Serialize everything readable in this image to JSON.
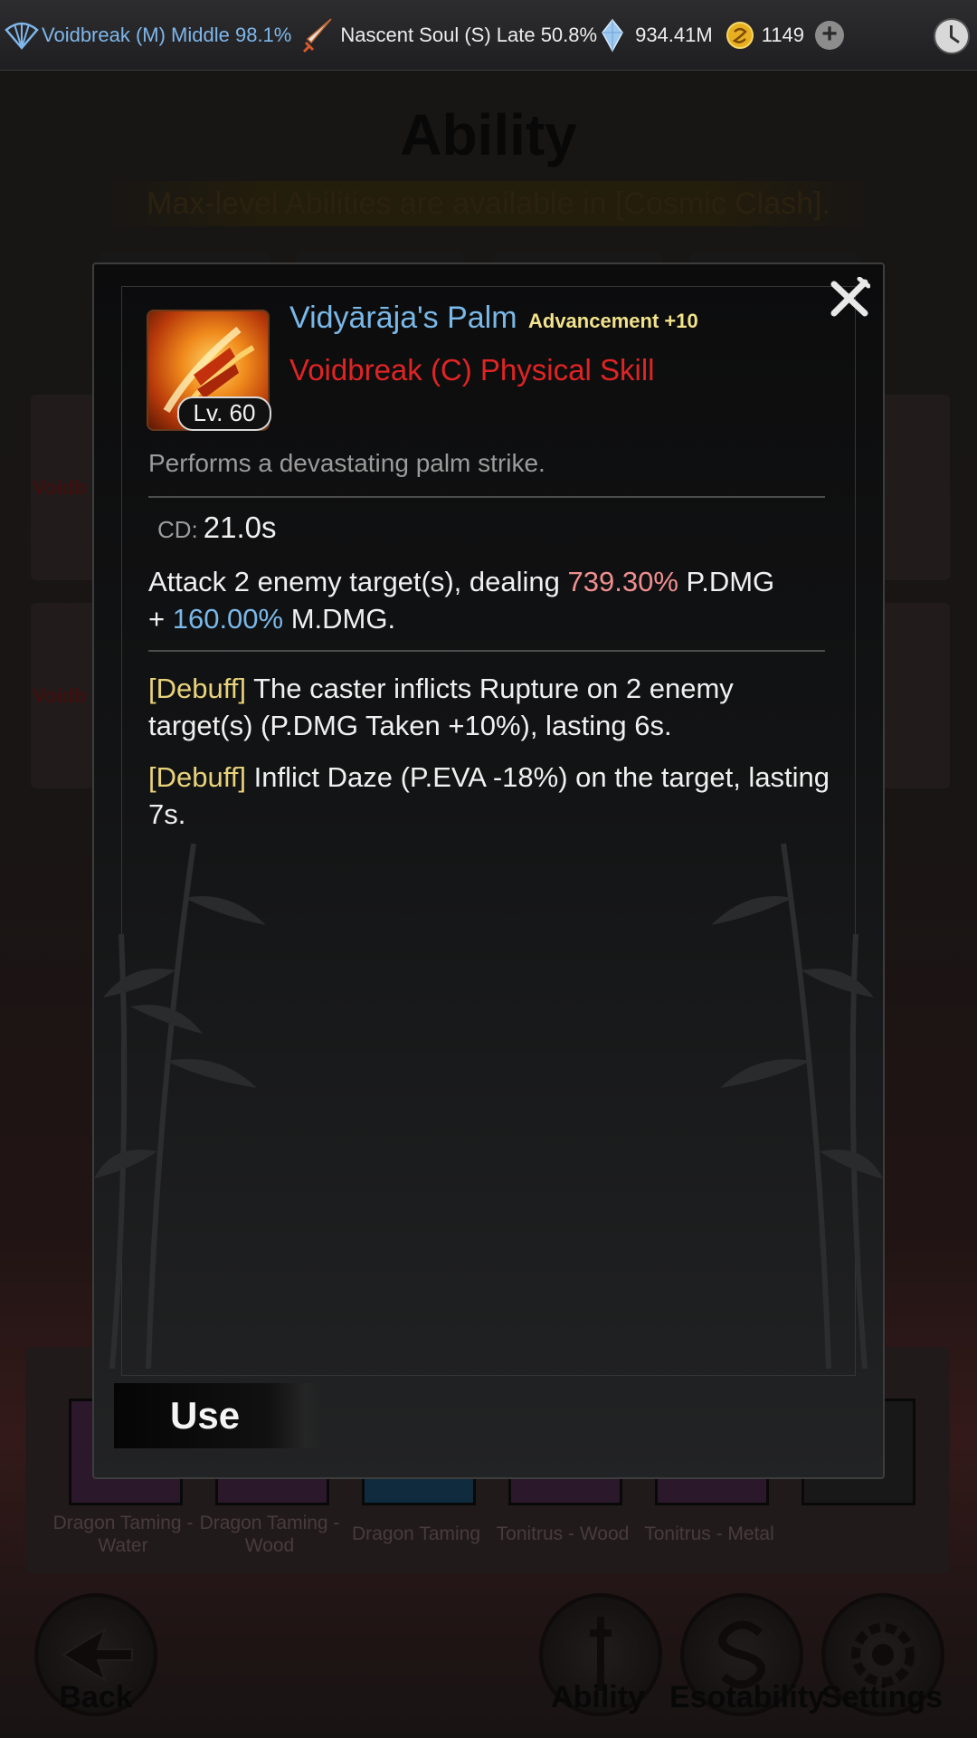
{
  "status_bar": {
    "cultivation_realm": "Voidbreak (M) Middle 98.1%",
    "soul_realm": "Nascent Soul (S) Late 50.8%",
    "spirit_stones": "934.41M",
    "gold": "1149"
  },
  "page": {
    "title": "Ability",
    "notice": "Max-level Abilities are available in [Cosmic Clash].",
    "card_labels": [
      "Voidb",
      "Voidb"
    ],
    "skill_tiles": [
      {
        "label": "Dragon Taming - Water",
        "color": "#5a2a6a"
      },
      {
        "label": "Dragon Taming - Wood",
        "color": "#6a2a6a"
      },
      {
        "label": "Dragon Taming",
        "color": "#1a4a6a"
      },
      {
        "label": "Tonitrus - Wood",
        "color": "#5a2a5a"
      },
      {
        "label": "Tonitrus - Metal",
        "color": "#5a2a6a"
      },
      {
        "label": "",
        "color": "#2a2a2a"
      }
    ],
    "nav": {
      "back": "Back",
      "ability": "Ability",
      "esotability": "Esotability",
      "settings": "Settings"
    }
  },
  "modal": {
    "skill_name": "Vidyārāja's Palm",
    "advancement": "Advancement +10",
    "skill_type": "Voidbreak (C) Physical Skill",
    "level": "Lv. 60",
    "description": "Performs a devastating palm strike.",
    "cd_label": "CD:",
    "cd_value": "21.0s",
    "attack": {
      "prefix": "Attack 2 enemy target(s), dealing ",
      "pdmg_value": "739.30%",
      "pdmg_suffix": " P.DMG",
      "plus": "+ ",
      "mdmg_value": "160.00%",
      "mdmg_suffix": " M.DMG."
    },
    "debuffs": [
      {
        "tag": "[Debuff]",
        "text": " The caster inflicts Rupture on 2 enemy target(s) (P.DMG Taken +10%), lasting 6s."
      },
      {
        "tag": "[Debuff]",
        "text": " Inflict Daze (P.EVA -18%) on the target, lasting 7s."
      }
    ],
    "use_label": "Use"
  },
  "colors": {
    "skill_name": "#7ab8e8",
    "skill_type": "#e02424",
    "advancement": "#f2e38c",
    "pdmg": "#f08f8f",
    "mdmg": "#7ab8e8",
    "debuff_tag": "#e8d27a"
  },
  "icons": [
    "fan-icon",
    "sword-icon",
    "crystal-icon",
    "coin-icon",
    "plus-icon",
    "clock-icon",
    "close-icon",
    "palm-skill-icon",
    "back-arrow-icon",
    "ability-icon",
    "esotability-icon",
    "settings-icon"
  ]
}
